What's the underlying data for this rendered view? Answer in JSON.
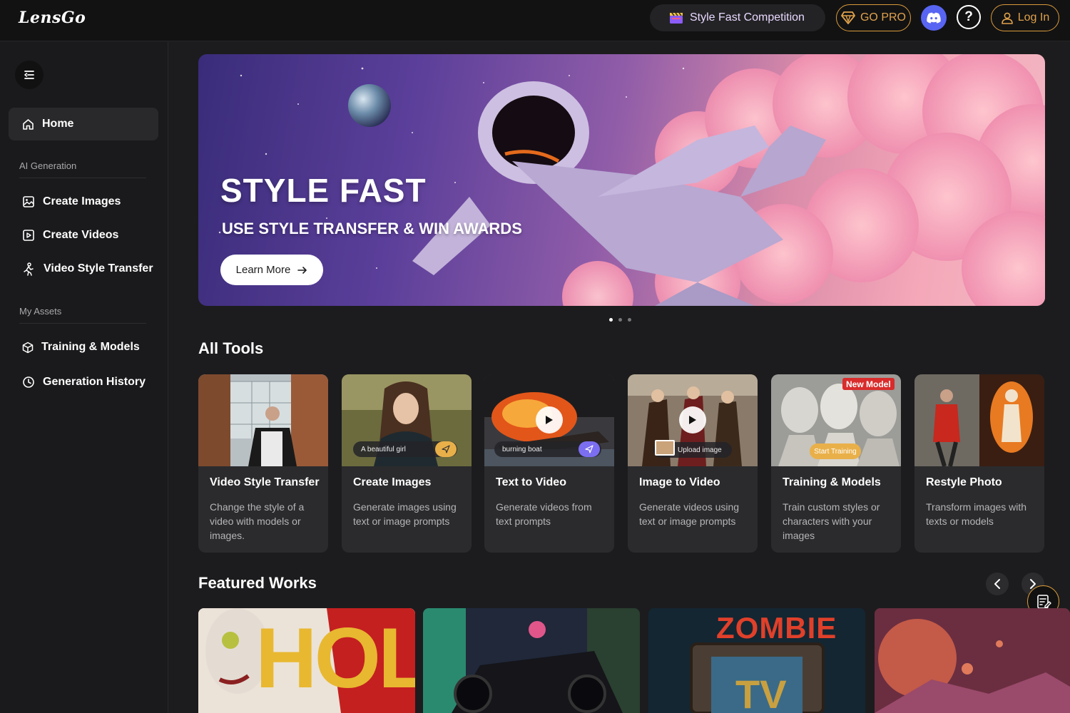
{
  "app": {
    "logo": "LensGo"
  },
  "header": {
    "competition_label": "Style Fast Competition",
    "gopro_label": "GO PRO",
    "login_label": "Log In"
  },
  "sidebar": {
    "home_label": "Home",
    "sections": [
      {
        "label": "AI Generation",
        "items": [
          "Create Images",
          "Create Videos",
          "Video Style Transfer"
        ]
      },
      {
        "label": "My Assets",
        "items": [
          "Training & Models",
          "Generation History"
        ]
      }
    ]
  },
  "hero": {
    "title": "STYLE FAST",
    "subtitle": "USE STYLE TRANSFER & WIN AWARDS",
    "button_label": "Learn More",
    "slides": 3,
    "active_slide": 1
  },
  "tools": {
    "heading": "All Tools",
    "items": [
      {
        "title": "Video Style Transfer",
        "desc": "Change the style of a video with models or images."
      },
      {
        "title": "Create Images",
        "desc": "Generate images using text or image prompts",
        "prompt": "A beautiful girl"
      },
      {
        "title": "Text to Video",
        "desc": "Generate videos from text prompts",
        "prompt": "burning boat"
      },
      {
        "title": "Image to Video",
        "desc": "Generate videos using text or image prompts",
        "prompt": "Upload image"
      },
      {
        "title": "Training & Models",
        "desc": "Train custom styles or characters with your images",
        "badge": "New Model",
        "action": "Start Training"
      },
      {
        "title": "Restyle Photo",
        "desc": "Transform images with texts or models"
      }
    ]
  },
  "featured": {
    "heading": "Featured Works",
    "items": [
      {
        "text": "HOLE"
      },
      {
        "text": ""
      },
      {
        "text": "ZOMBIE",
        "text2": "TV"
      },
      {
        "text": ""
      }
    ]
  },
  "colors": {
    "accent": "#e0a24b",
    "discord": "#5865f2",
    "badge_red": "#d92c2c"
  }
}
